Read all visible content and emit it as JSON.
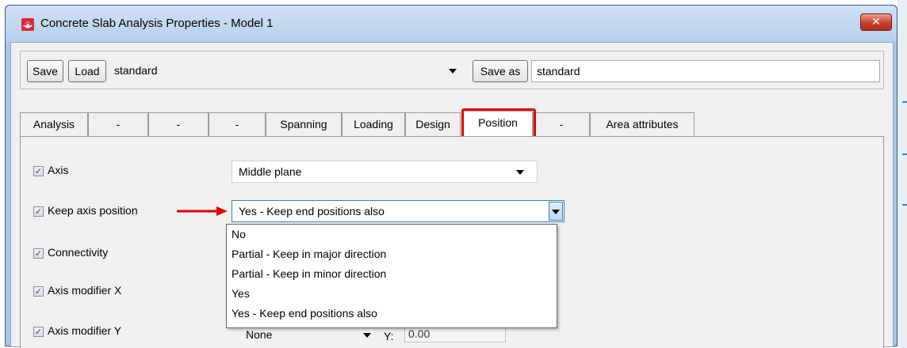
{
  "window": {
    "title": "Concrete Slab Analysis Properties - Model 1",
    "close_glyph": "✕",
    "icon": "app-icon"
  },
  "toolbar": {
    "save_label": "Save",
    "load_label": "Load",
    "load_value": "standard",
    "save_as_label": "Save as",
    "save_as_value": "standard"
  },
  "tabs": [
    {
      "label": "Analysis"
    },
    {
      "label": "-"
    },
    {
      "label": "-"
    },
    {
      "label": "-"
    },
    {
      "label": "Spanning"
    },
    {
      "label": "Loading"
    },
    {
      "label": "Design"
    },
    {
      "label": "Position",
      "active": true
    },
    {
      "label": "-"
    },
    {
      "label": "Area attributes"
    }
  ],
  "rows": [
    {
      "label": "Axis",
      "checked": true,
      "value": "Middle plane"
    },
    {
      "label": "Keep axis position",
      "checked": true,
      "value": "Yes - Keep end positions also"
    },
    {
      "label": "Connectivity",
      "checked": true
    },
    {
      "label": "Axis modifier X",
      "checked": true
    },
    {
      "label": "Axis modifier Y",
      "checked": true,
      "value": "None",
      "y_label": "Y:",
      "y_value": "0.00"
    }
  ],
  "dropdown_options": [
    "No",
    "Partial - Keep in major direction",
    "Partial - Keep in minor direction",
    "Yes",
    "Yes - Keep end positions also"
  ],
  "check_glyph": "✓",
  "colors": {
    "highlight": "#e00000",
    "annotation_arrow": "#e00000",
    "titlebar": "#b8d0ec"
  }
}
